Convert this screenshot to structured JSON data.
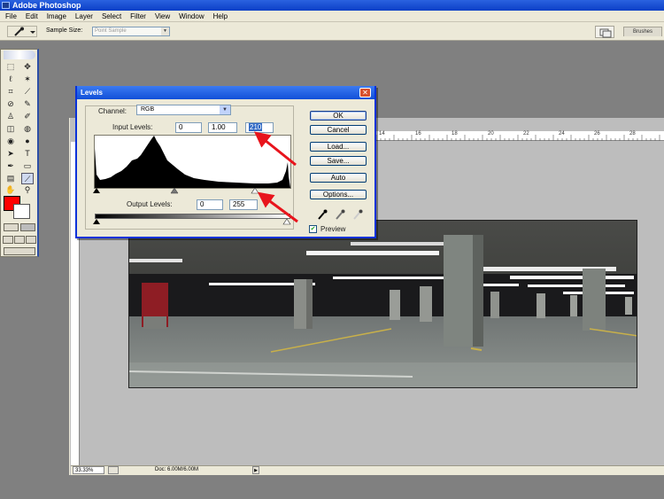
{
  "app": {
    "title": "Adobe Photoshop"
  },
  "menubar": {
    "items": [
      "File",
      "Edit",
      "Image",
      "Layer",
      "Select",
      "Filter",
      "View",
      "Window",
      "Help"
    ]
  },
  "options": {
    "sample_size_label": "Sample Size:",
    "sample_size_value": "Point Sample"
  },
  "palette": {
    "brushes_tab": "Brushes"
  },
  "rulers": {
    "top_ticks": [
      "14",
      "16",
      "18",
      "20",
      "22",
      "24",
      "26",
      "28"
    ]
  },
  "status": {
    "zoom": "33.33%",
    "doc_size": "Doc: 6.00M/6.00M"
  },
  "levels": {
    "title": "Levels",
    "channel_label": "Channel:",
    "channel_value": "RGB",
    "input_levels_label": "Input Levels:",
    "input_black": "0",
    "input_gamma": "1.00",
    "input_white": "210",
    "output_levels_label": "Output Levels:",
    "output_black": "0",
    "output_white": "255",
    "buttons": {
      "ok": "OK",
      "cancel": "Cancel",
      "load": "Load...",
      "save": "Save...",
      "auto": "Auto",
      "options": "Options..."
    },
    "preview_label": "Preview",
    "preview_checked": true
  },
  "colors": {
    "foreground": "#ff0000",
    "background": "#ffffff",
    "annotation_arrow": "#e8141c",
    "title_bar": "#0b3fc6"
  }
}
